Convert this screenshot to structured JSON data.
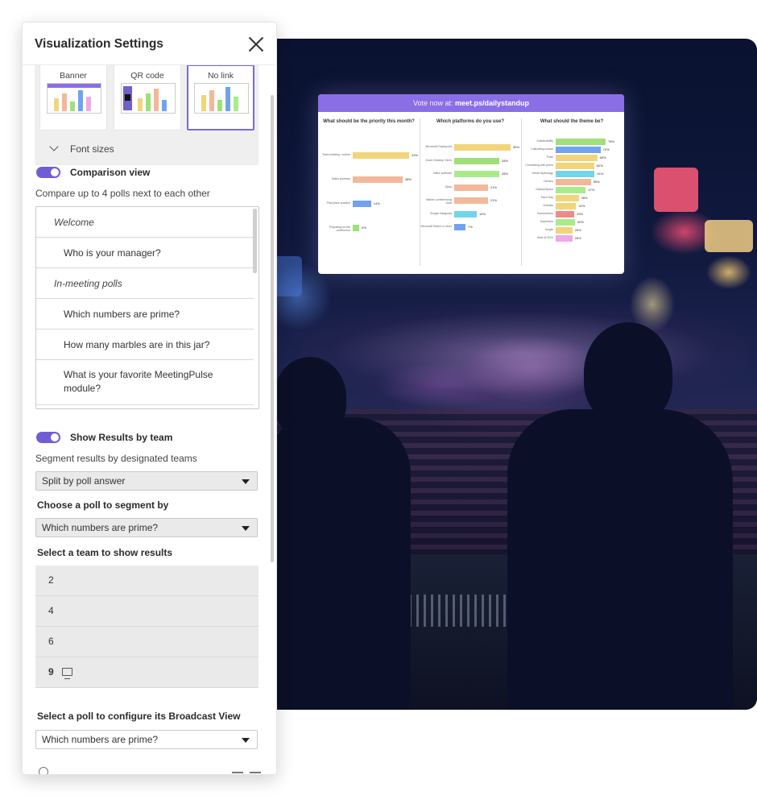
{
  "panel": {
    "title": "Visualization Settings",
    "link_options": [
      {
        "label": "Banner"
      },
      {
        "label": "QR code"
      },
      {
        "label": "No link",
        "selected": true
      }
    ],
    "font_sizes_label": "Font sizes",
    "comparison": {
      "toggle_label": "Comparison view",
      "enabled": true,
      "description": "Compare up to 4 polls next to each other",
      "items": [
        {
          "type": "group",
          "label": "Welcome"
        },
        {
          "type": "question",
          "label": "Who is your manager?"
        },
        {
          "type": "group",
          "label": "In-meeting polls"
        },
        {
          "type": "question",
          "label": "Which numbers are prime?"
        },
        {
          "type": "question",
          "label": "How many marbles are in this jar?"
        },
        {
          "type": "question",
          "label": "What is your favorite MeetingPulse module?"
        }
      ]
    },
    "team_results": {
      "toggle_label": "Show Results by team",
      "enabled": true,
      "description": "Segment results by designated teams",
      "split_select": "Split by poll answer",
      "choose_poll_label": "Choose a poll to segment by",
      "poll_select": "Which numbers are prime?",
      "select_team_label": "Select a team to show results",
      "teams": [
        "2",
        "4",
        "6",
        "9"
      ],
      "broadcast_team": "9"
    },
    "broadcast": {
      "label": "Select a poll to configure its Broadcast View",
      "select": "Which numbers are prime?"
    }
  },
  "screen": {
    "vote_prefix": "Vote now at:",
    "vote_url": "meet.ps/dailystandup",
    "columns": [
      {
        "question": "What should be the priority this month?",
        "bars": [
          {
            "label": "Team building / culture",
            "value": 43,
            "color": "#f2d57a"
          },
          {
            "label": "Sales increase",
            "value": 38,
            "color": "#f2b89a"
          },
          {
            "label": "Pilot plans practice",
            "value": 14,
            "color": "#6fa3f0"
          },
          {
            "label": "Preparing for the conference",
            "value": 5,
            "color": "#9fe07a"
          }
        ]
      },
      {
        "question": "Which platforms do you use?",
        "bars": [
          {
            "label": "Microsoft Powerpoint",
            "value": 35,
            "color": "#f2d57a"
          },
          {
            "label": "Zoom Desktop Client",
            "value": 28,
            "color": "#9fe07a"
          },
          {
            "label": "Office software",
            "value": 28,
            "color": "#a8ec8a"
          },
          {
            "label": "Slack",
            "value": 21,
            "color": "#f2b89a"
          },
          {
            "label": "Webex conferencing tools",
            "value": 21,
            "color": "#f2b89a"
          },
          {
            "label": "Google Hangouts",
            "value": 14,
            "color": "#6fd6e8"
          },
          {
            "label": "Microsoft Teams or other",
            "value": 7,
            "color": "#6fa3f0"
          }
        ]
      },
      {
        "question": "What should the theme be?",
        "bars": [
          {
            "label": "Sustainability",
            "value": 78,
            "color": "#9fe07a"
          },
          {
            "label": "Cultivating culture",
            "value": 70,
            "color": "#6fa3f0"
          },
          {
            "label": "Poke",
            "value": 65,
            "color": "#f2d57a"
          },
          {
            "label": "Connecting with peers",
            "value": 60,
            "color": "#f2d57a"
          },
          {
            "label": "Greek Mythology",
            "value": 61,
            "color": "#6fd6e8"
          },
          {
            "label": "Oceans",
            "value": 55,
            "color": "#f2b89a"
          },
          {
            "label": "Galaxy/Space",
            "value": 47,
            "color": "#a8ec8a"
          },
          {
            "label": "Each Day",
            "value": 36,
            "color": "#f2d57a"
          },
          {
            "label": "Animals",
            "value": 32,
            "color": "#f2d57a"
          },
          {
            "label": "Summertime",
            "value": 29,
            "color": "#f08a8a"
          },
          {
            "label": "Superhero",
            "value": 30,
            "color": "#a8ec8a"
          },
          {
            "label": "Jungle",
            "value": 26,
            "color": "#f2d57a"
          },
          {
            "label": "Best of 2022",
            "value": 26,
            "color": "#f0a8e8"
          }
        ]
      }
    ]
  },
  "colors": {
    "accent": "#6f5ed3",
    "banner_purple": "#8a6ee6"
  }
}
